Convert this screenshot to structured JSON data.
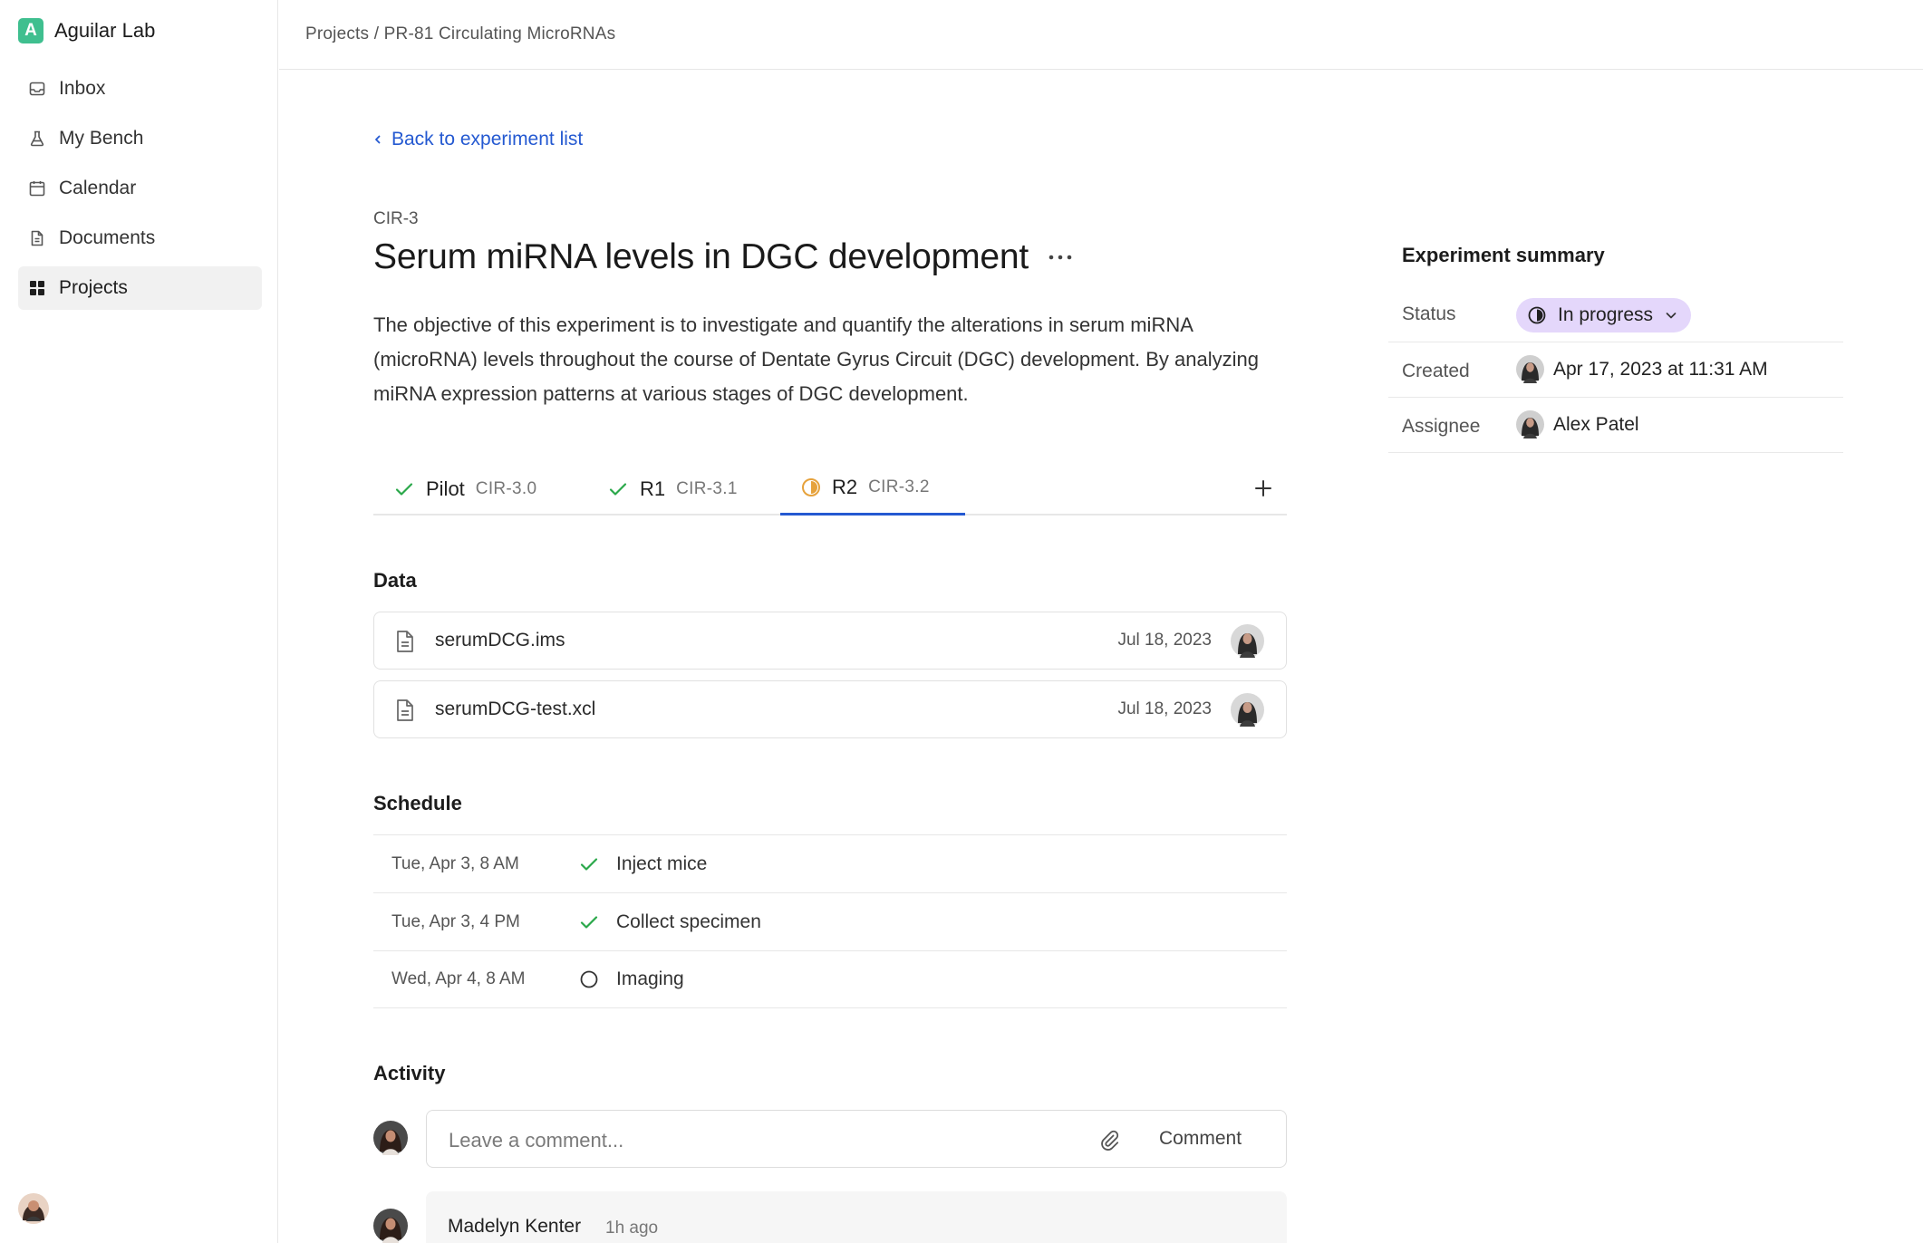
{
  "app": {
    "name": "Aguilar Lab",
    "brand_letter": "A",
    "brand_color": "#3fbf8f"
  },
  "sidebar": {
    "items": [
      {
        "label": "Inbox",
        "icon": "inbox-icon"
      },
      {
        "label": "My Bench",
        "icon": "flask-icon"
      },
      {
        "label": "Calendar",
        "icon": "calendar-icon"
      },
      {
        "label": "Documents",
        "icon": "document-icon"
      },
      {
        "label": "Projects",
        "icon": "grid-icon",
        "active": true
      }
    ]
  },
  "header": {
    "breadcrumb": "Projects / PR-81 Circulating MicroRNAs"
  },
  "experiment": {
    "back_label": "Back to experiment list",
    "id": "CIR-3",
    "title": "Serum miRNA levels in DGC development",
    "description": "The objective of this experiment is to investigate and quantify the alterations in serum miRNA (microRNA) levels throughout the course of Dentate Gyrus Circuit (DGC) development. By analyzing miRNA expression patterns at various stages of DGC development."
  },
  "tabs": [
    {
      "label": "Pilot",
      "code": "CIR-3.0",
      "status": "done"
    },
    {
      "label": "R1",
      "code": "CIR-3.1",
      "status": "done"
    },
    {
      "label": "R2",
      "code": "CIR-3.2",
      "status": "in-progress",
      "active": true
    }
  ],
  "data_section": {
    "title": "Data",
    "files": [
      {
        "name": "serumDCG.ims",
        "date": "Jul 18, 2023"
      },
      {
        "name": "serumDCG-test.xcl",
        "date": "Jul 18, 2023"
      }
    ]
  },
  "schedule": {
    "title": "Schedule",
    "items": [
      {
        "time": "Tue, Apr 3, 8 AM",
        "task": "Inject mice",
        "done": true
      },
      {
        "time": "Tue, Apr 3, 4 PM",
        "task": "Collect specimen",
        "done": true
      },
      {
        "time": "Wed, Apr 4, 8 AM",
        "task": "Imaging",
        "done": false
      }
    ]
  },
  "activity": {
    "title": "Activity",
    "comment_placeholder": "Leave a comment...",
    "comment_button": "Comment",
    "entries": [
      {
        "author": "Madelyn Kenter",
        "time": "1h ago"
      }
    ]
  },
  "summary": {
    "title": "Experiment summary",
    "status_label": "Status",
    "status_value": "In progress",
    "status_color": "#e4d7fb",
    "created_label": "Created",
    "created_value": "Apr 17, 2023 at 11:31 AM",
    "assignee_label": "Assignee",
    "assignee_value": "Alex Patel"
  },
  "colors": {
    "accent": "#2459d1",
    "done": "#2aa84a",
    "in_progress": "#e6a23c"
  }
}
